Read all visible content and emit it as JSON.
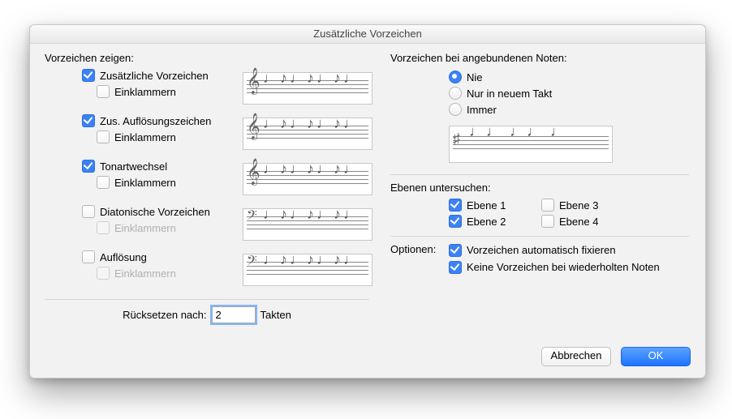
{
  "title": "Zusätzliche Vorzeichen",
  "left": {
    "section_label": "Vorzeichen zeigen:",
    "bracket_label": "Einklammern",
    "options": [
      {
        "label": "Zusätzliche Vorzeichen",
        "checked": true,
        "bracket_enabled": true,
        "bracket_checked": false,
        "clef": "treble"
      },
      {
        "label": "Zus. Auflösungszeichen",
        "checked": true,
        "bracket_enabled": true,
        "bracket_checked": false,
        "clef": "treble"
      },
      {
        "label": "Tonartwechsel",
        "checked": true,
        "bracket_enabled": true,
        "bracket_checked": false,
        "clef": "treble"
      },
      {
        "label": "Diatonische Vorzeichen",
        "checked": false,
        "bracket_enabled": false,
        "bracket_checked": false,
        "clef": "bass"
      },
      {
        "label": "Auflösung",
        "checked": false,
        "bracket_enabled": false,
        "bracket_checked": false,
        "clef": "bass"
      }
    ],
    "reset": {
      "label": "Rücksetzen nach:",
      "value": "2",
      "unit": "Takten"
    }
  },
  "right": {
    "tied": {
      "section_label": "Vorzeichen bei angebundenen Noten:",
      "options": [
        {
          "label": "Nie",
          "selected": true
        },
        {
          "label": "Nur in neuem Takt",
          "selected": false
        },
        {
          "label": "Immer",
          "selected": false
        }
      ]
    },
    "layers": {
      "section_label": "Ebenen untersuchen:",
      "items": [
        {
          "label": "Ebene 1",
          "checked": true
        },
        {
          "label": "Ebene 3",
          "checked": false
        },
        {
          "label": "Ebene 2",
          "checked": true
        },
        {
          "label": "Ebene 4",
          "checked": false
        }
      ]
    },
    "options": {
      "section_label": "Optionen:",
      "items": [
        {
          "label": "Vorzeichen automatisch fixieren",
          "checked": true
        },
        {
          "label": "Keine Vorzeichen bei wiederholten Noten",
          "checked": true
        }
      ]
    }
  },
  "buttons": {
    "cancel": "Abbrechen",
    "ok": "OK"
  }
}
